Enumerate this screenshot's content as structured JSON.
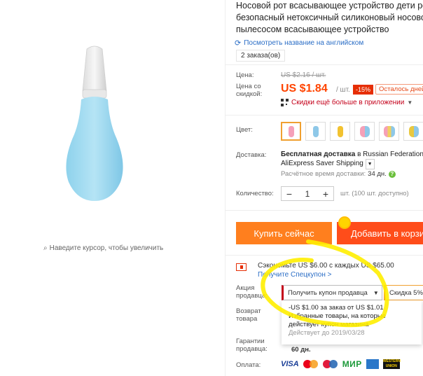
{
  "product": {
    "title_lines": [
      "Носовой рот всасывающее устройство дети ребе",
      "безопасный нетоксичный силиконовый носовой",
      "пылесосом всасывающее устройство"
    ],
    "translate_link": "Посмотреть название на английском",
    "orders": "2 заказа(ов)",
    "zoom_hint": "Наведите курсор, чтобы увеличить"
  },
  "price": {
    "label_price": "Цена:",
    "old": "US $2.16 / шт.",
    "label_discount": "Цена со скидкой:",
    "new": "US $1.84",
    "unit": "/ шт.",
    "discount_badge": "-15%",
    "remaining": "Осталось дней",
    "app_promo": "Скидки ещё больше в приложении"
  },
  "options": {
    "color_label": "Цвет:",
    "swatch_colors": [
      "#f5a0b8",
      "#8ec8e8",
      "#f2c230",
      "#d8a8e0",
      "#f0d060",
      "#e8c840"
    ]
  },
  "shipping": {
    "label": "Доставка:",
    "line1_bold": "Бесплатная доставка",
    "line1_rest": " в Russian Federation с",
    "line2": "AliExpress Saver Shipping",
    "est_label": "Расчётное время доставки:",
    "est_value": "34 дн."
  },
  "quantity": {
    "label": "Количество:",
    "value": "1",
    "minus": "−",
    "plus": "+",
    "note": "шт. (100 шт. доступно)"
  },
  "actions": {
    "buy_now": "Купить сейчас",
    "add_to_cart": "Добавить в корзи"
  },
  "coupon": {
    "save_text": "Сэкономьте US $6.00 с каждых US $65.00",
    "get_coupon": "Получите Спецкупон >",
    "seller_label": "Акция продавца:",
    "select_label": "Получить купон продавца",
    "discount_chip": "Скидка 5%",
    "dropdown_line1": "-US $1.00 за заказ от US $1.01",
    "dropdown_line2": "Избранные товары, на которые",
    "dropdown_line3": "действует купон магазина",
    "dropdown_valid": "Действует до 2019/03/28"
  },
  "returns": {
    "label": "Возврат товара"
  },
  "warranty": {
    "label": "Гарантии продавца:",
    "value": "60 дн."
  },
  "payment": {
    "label": "Оплата:",
    "visa": "VISA",
    "mir": "МИР",
    "wu": "WESTERN UNION"
  },
  "colors": {
    "accent_orange": "#ff7f1e",
    "accent_red": "#ff4d1a",
    "price_red": "#ff4400",
    "link_blue": "#2b6ec6",
    "annotation_yellow": "#ffee00"
  }
}
